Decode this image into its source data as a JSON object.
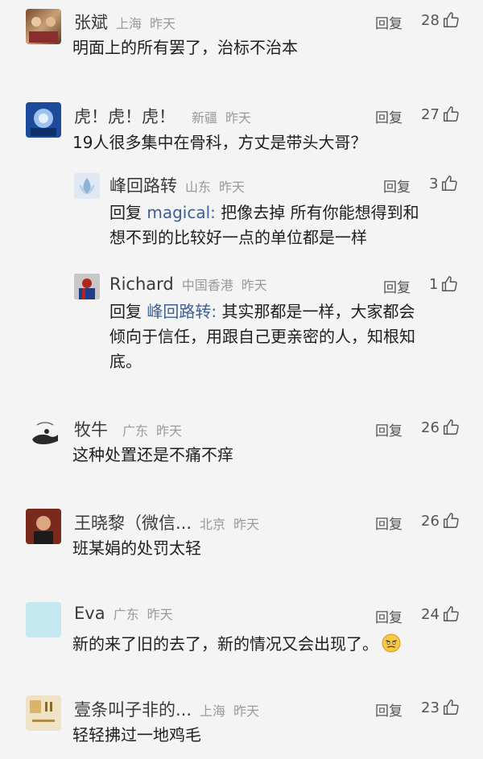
{
  "labels": {
    "reply": "回复"
  },
  "comments": [
    {
      "name": "张斌",
      "location": "上海",
      "time": "昨天",
      "likes": "28",
      "text": "明面上的所有罢了，治标不治本"
    },
    {
      "name": "虎！虎！虎！",
      "location": "新疆",
      "time": "昨天",
      "likes": "27",
      "text": "19人很多集中在骨科，方丈是带头大哥？",
      "replies": [
        {
          "name": "峰回路转",
          "location": "山东",
          "time": "昨天",
          "likes": "3",
          "prefix": "回复 ",
          "target": "magical:",
          "line1": " 把像去掉 所有你能想得到和",
          "line2": "想不到的比较好一点的单位都是一样"
        },
        {
          "name": "Richard",
          "location": "中国香港",
          "time": "昨天",
          "likes": "1",
          "prefix": "回复 ",
          "target": "峰回路转:",
          "line1": " 其实那都是一样，大家都会",
          "line2": "倾向于信任，用跟自己更亲密的人，知根知",
          "line3": "底。"
        }
      ]
    },
    {
      "name": "牧牛",
      "location": "广东",
      "time": "昨天",
      "likes": "26",
      "text": "这种处置还是不痛不痒"
    },
    {
      "name": "王晓黎（微信...",
      "location": "北京",
      "time": "昨天",
      "likes": "26",
      "text": "班某娟的处罚太轻"
    },
    {
      "name": "Eva",
      "location": "广东",
      "time": "昨天",
      "likes": "24",
      "text": "新的来了旧的去了，新的情况又会出现了。",
      "emoji": "smirk-emoji"
    },
    {
      "name": "壹条叫子非的...",
      "location": "上海",
      "time": "昨天",
      "likes": "23",
      "text": "轻轻拂过一地鸡毛"
    }
  ],
  "icons": {
    "like": "thumbs-up-icon"
  }
}
